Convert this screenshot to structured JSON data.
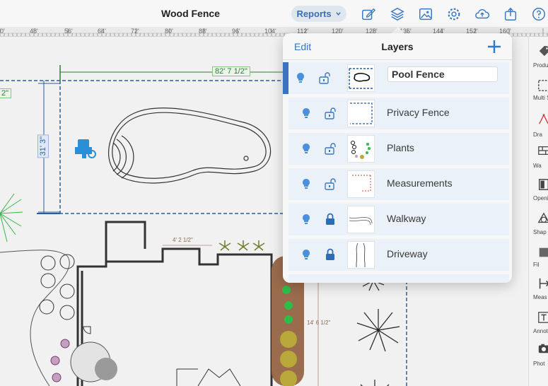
{
  "topbar": {
    "title": "Wood Fence",
    "reports_label": "Reports",
    "icons": [
      "edit-icon",
      "layers-icon",
      "image-icon",
      "gear-icon",
      "cloud-upload-icon",
      "share-icon",
      "help-icon"
    ]
  },
  "ruler": {
    "labels": [
      "0'",
      "48'",
      "56'",
      "64'",
      "72'",
      "80'",
      "88'",
      "96'",
      "104'",
      "112'",
      "120'",
      "128'",
      "136'",
      "144'",
      "152'",
      "160'"
    ]
  },
  "canvas": {
    "measure_horizontal": "82' 7 1/2\"",
    "measure_left_cut": "2\"",
    "measure_vertical": "31' 3\"",
    "house_label_1": "4' 2 1/2\"",
    "house_label_2": "14' 6 1/2\""
  },
  "layers_popover": {
    "edit_label": "Edit",
    "title": "Layers",
    "add_label": "+",
    "layers": [
      {
        "name": "Pool Fence",
        "locked": false,
        "selected": true
      },
      {
        "name": "Privacy Fence",
        "locked": false,
        "selected": false
      },
      {
        "name": "Plants",
        "locked": false,
        "selected": false
      },
      {
        "name": "Measurements",
        "locked": false,
        "selected": false
      },
      {
        "name": "Walkway",
        "locked": true,
        "selected": false
      },
      {
        "name": "Driveway",
        "locked": true,
        "selected": false
      }
    ]
  },
  "toolstrip": {
    "items": [
      {
        "label": "Produ",
        "icon": "tag-icon"
      },
      {
        "label": "Multi Sele",
        "icon": "multi-select-icon"
      },
      {
        "label": "Dra",
        "icon": "draw-icon"
      },
      {
        "label": "Wa",
        "icon": "wall-icon"
      },
      {
        "label": "Openi",
        "icon": "opening-icon"
      },
      {
        "label": "Shap",
        "icon": "shape-icon"
      },
      {
        "label": "Fil",
        "icon": "fill-icon"
      },
      {
        "label": "Meas",
        "icon": "measure-icon"
      },
      {
        "label": "Annot",
        "icon": "annotation-icon"
      },
      {
        "label": "Phot",
        "icon": "photo-icon"
      }
    ]
  },
  "colors": {
    "accent": "#2f77d0",
    "selection": "#3b73c0",
    "row_bg": "#eaf1f8",
    "measure_green": "#2e7d32",
    "fence_blue": "#2b5d9b"
  }
}
